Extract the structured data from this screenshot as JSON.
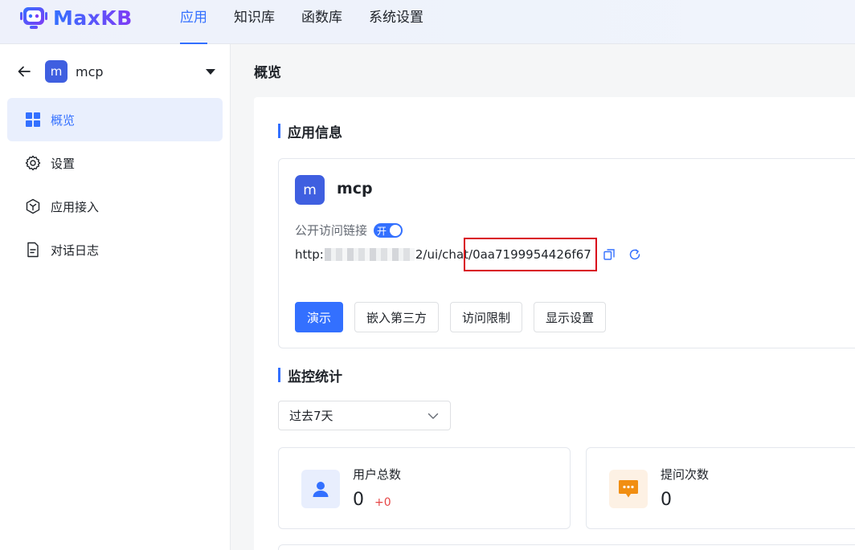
{
  "header": {
    "logo_text": "MaxKB",
    "nav": [
      {
        "label": "应用",
        "active": true
      },
      {
        "label": "知识库",
        "active": false
      },
      {
        "label": "函数库",
        "active": false
      },
      {
        "label": "系统设置",
        "active": false
      }
    ]
  },
  "sidebar": {
    "app_avatar": "m",
    "app_name": "mcp",
    "menu": [
      {
        "label": "概览",
        "icon": "grid-icon",
        "active": true
      },
      {
        "label": "设置",
        "icon": "gear-icon",
        "active": false
      },
      {
        "label": "应用接入",
        "icon": "cube-icon",
        "active": false
      },
      {
        "label": "对话日志",
        "icon": "document-icon",
        "active": false
      }
    ]
  },
  "main": {
    "page_title": "概览",
    "app_info": {
      "section_title": "应用信息",
      "avatar": "m",
      "name": "mcp",
      "public_link_label": "公开访问链接",
      "toggle_label": "开",
      "url_prefix": "http:",
      "url_mid": "2/ui/chat",
      "url_hash": "/0aa7199954426f67",
      "buttons": {
        "demo": "演示",
        "embed": "嵌入第三方",
        "access": "访问限制",
        "display": "显示设置"
      }
    },
    "monitor": {
      "section_title": "监控统计",
      "range_selected": "过去7天",
      "stats": [
        {
          "label": "用户总数",
          "value": "0",
          "delta": "+0"
        },
        {
          "label": "提问次数",
          "value": "0"
        }
      ]
    }
  },
  "colors": {
    "primary": "#3370ff",
    "highlight_border": "#d9001b",
    "avatar_bg": "#3f5fe0",
    "stat_user_bg": "#e8eefd",
    "stat_question_bg": "#fdf1e4",
    "stat_question_icon": "#f18e12"
  }
}
